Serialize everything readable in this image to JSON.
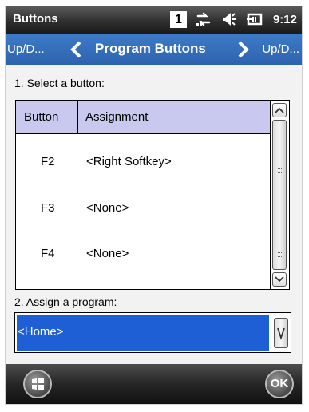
{
  "status_bar": {
    "title": "Buttons",
    "indicator": "1",
    "time": "9:12",
    "icons": [
      "network-arrows-icon",
      "speaker-icon",
      "battery-icon"
    ]
  },
  "nav": {
    "left_label": "Up/D...",
    "center_label": "Program Buttons",
    "right_label": "Up/D..."
  },
  "section1": {
    "label": "1. Select a button:"
  },
  "table": {
    "headers": [
      "Button",
      "Assignment"
    ],
    "rows": [
      {
        "button": "F2",
        "assignment": "<Right Softkey>"
      },
      {
        "button": "F3",
        "assignment": "<None>"
      },
      {
        "button": "F4",
        "assignment": "<None>"
      }
    ]
  },
  "section2": {
    "label": "2. Assign a program:"
  },
  "program_select": {
    "value": "<Home>"
  },
  "softkeys": {
    "ok_label": "OK"
  },
  "colors": {
    "nav_blue": "#2d62ad",
    "header_lavender": "#c9c9ef",
    "selection_blue": "#1f5fd6"
  }
}
